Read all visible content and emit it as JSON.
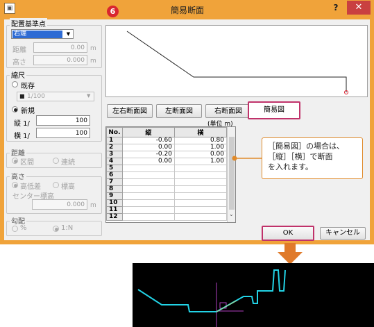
{
  "window": {
    "title": "簡易断面",
    "step": "6",
    "help": "?",
    "close": "✕"
  },
  "placement": {
    "group": "配置基準点",
    "select_value": "右端",
    "distance_label": "距離",
    "distance_value": "0.00",
    "height_label": "高さ",
    "height_value": "0.000",
    "unit_m": "m"
  },
  "scale": {
    "group": "縮尺",
    "existing": "既存",
    "existing_select": "1/100",
    "new": "新規",
    "vertical_label": "縦 1/",
    "vertical_value": "100",
    "horizontal_label": "横 1/",
    "horizontal_value": "100"
  },
  "distance": {
    "group": "距離",
    "interval": "区間",
    "continuous": "連続"
  },
  "height": {
    "group": "高さ",
    "height_diff": "高低差",
    "elevation": "標高",
    "center_elev": "センター標高",
    "center_value": "0.000",
    "unit_m": "m"
  },
  "slope": {
    "group": "勾配",
    "percent": "%",
    "ratio": "1:N"
  },
  "section_buttons": [
    "左右断面図",
    "左断面図",
    "右断面図",
    "簡易図"
  ],
  "unit_note": "(単位 m)",
  "table": {
    "headers": [
      "No.",
      "縦",
      "横"
    ],
    "rows": [
      {
        "no": "1",
        "v": "-0.60",
        "h": "0.80"
      },
      {
        "no": "2",
        "v": "0.00",
        "h": "1.00"
      },
      {
        "no": "3",
        "v": "-0.20",
        "h": "0.00"
      },
      {
        "no": "4",
        "v": "0.00",
        "h": "1.00"
      },
      {
        "no": "5",
        "v": "",
        "h": ""
      },
      {
        "no": "6",
        "v": "",
        "h": ""
      },
      {
        "no": "7",
        "v": "",
        "h": ""
      },
      {
        "no": "8",
        "v": "",
        "h": ""
      },
      {
        "no": "9",
        "v": "",
        "h": ""
      },
      {
        "no": "10",
        "v": "",
        "h": ""
      },
      {
        "no": "11",
        "v": "",
        "h": ""
      },
      {
        "no": "12",
        "v": "",
        "h": ""
      }
    ]
  },
  "callout": {
    "line1": "［簡易図］の場合は、",
    "line2": "［縦］［横］で断面",
    "line3": "を入れます。"
  },
  "ok": "OK",
  "cancel": "キャンセル",
  "colors": {
    "accent_orange": "#f0a33a",
    "highlight": "#c0326a",
    "badge_red": "#d9262f",
    "cad_cyan": "#22d3e6",
    "cad_bg": "#000000"
  }
}
